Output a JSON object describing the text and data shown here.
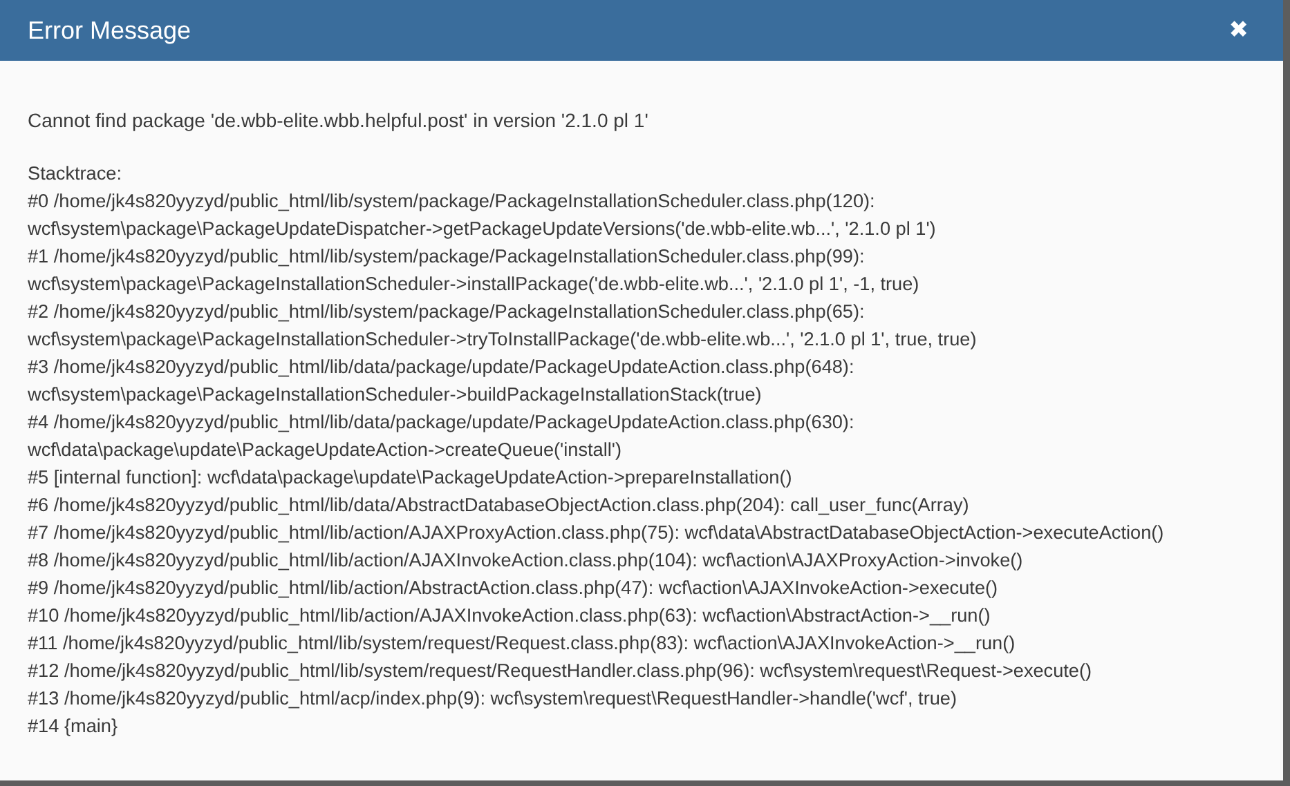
{
  "dialog": {
    "title": "Error Message",
    "close": "✖",
    "message": "Cannot find package 'de.wbb-elite.wbb.helpful.post' in version '2.1.0 pl 1'",
    "stacktrace_label": "Stacktrace:",
    "stacktrace": [
      "#0 /home/jk4s820yyzyd/public_html/lib/system/package/PackageInstallationScheduler.class.php(120):",
      "wcf\\system\\package\\PackageUpdateDispatcher->getPackageUpdateVersions('de.wbb-elite.wb...', '2.1.0 pl 1')",
      "#1 /home/jk4s820yyzyd/public_html/lib/system/package/PackageInstallationScheduler.class.php(99):",
      "wcf\\system\\package\\PackageInstallationScheduler->installPackage('de.wbb-elite.wb...', '2.1.0 pl 1', -1, true)",
      "#2 /home/jk4s820yyzyd/public_html/lib/system/package/PackageInstallationScheduler.class.php(65):",
      "wcf\\system\\package\\PackageInstallationScheduler->tryToInstallPackage('de.wbb-elite.wb...', '2.1.0 pl 1', true, true)",
      "#3 /home/jk4s820yyzyd/public_html/lib/data/package/update/PackageUpdateAction.class.php(648):",
      "wcf\\system\\package\\PackageInstallationScheduler->buildPackageInstallationStack(true)",
      "#4 /home/jk4s820yyzyd/public_html/lib/data/package/update/PackageUpdateAction.class.php(630):",
      "wcf\\data\\package\\update\\PackageUpdateAction->createQueue('install')",
      "#5 [internal function]: wcf\\data\\package\\update\\PackageUpdateAction->prepareInstallation()",
      "#6 /home/jk4s820yyzyd/public_html/lib/data/AbstractDatabaseObjectAction.class.php(204): call_user_func(Array)",
      "#7 /home/jk4s820yyzyd/public_html/lib/action/AJAXProxyAction.class.php(75): wcf\\data\\AbstractDatabaseObjectAction->executeAction()",
      "#8 /home/jk4s820yyzyd/public_html/lib/action/AJAXInvokeAction.class.php(104): wcf\\action\\AJAXProxyAction->invoke()",
      "#9 /home/jk4s820yyzyd/public_html/lib/action/AbstractAction.class.php(47): wcf\\action\\AJAXInvokeAction->execute()",
      "#10 /home/jk4s820yyzyd/public_html/lib/action/AJAXInvokeAction.class.php(63): wcf\\action\\AbstractAction->__run()",
      "#11 /home/jk4s820yyzyd/public_html/lib/system/request/Request.class.php(83): wcf\\action\\AJAXInvokeAction->__run()",
      "#12 /home/jk4s820yyzyd/public_html/lib/system/request/RequestHandler.class.php(96): wcf\\system\\request\\Request->execute()",
      "#13 /home/jk4s820yyzyd/public_html/acp/index.php(9): wcf\\system\\request\\RequestHandler->handle('wcf', true)",
      "#14 {main}"
    ]
  }
}
